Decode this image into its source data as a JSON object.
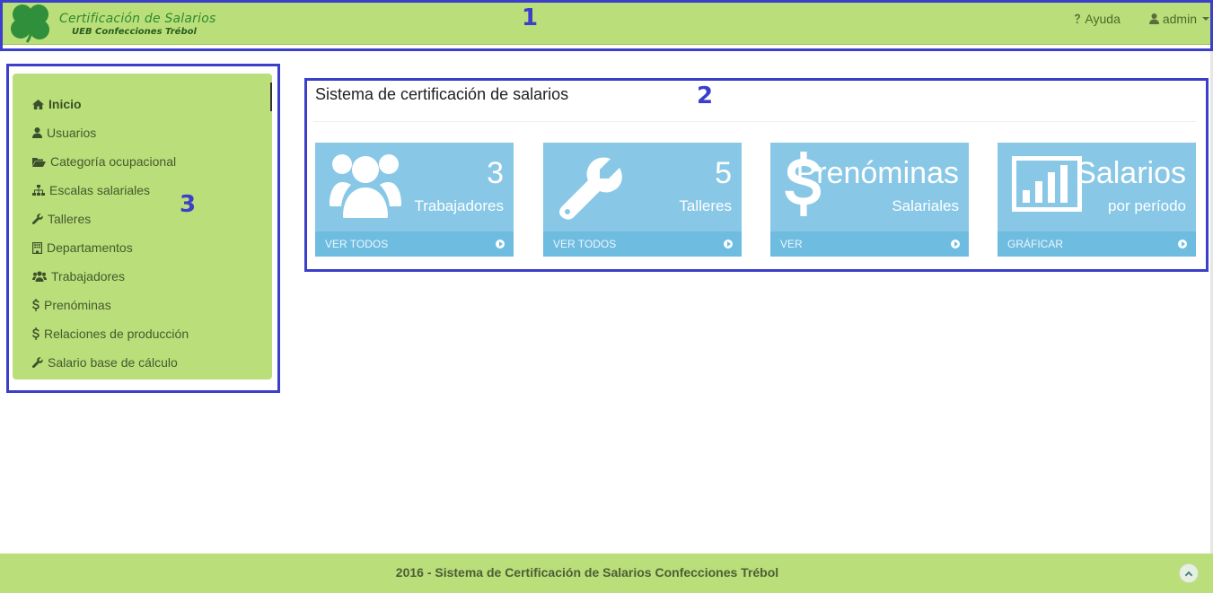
{
  "header": {
    "brand_title": "Certificación de Salarios",
    "brand_subtitle": "UEB Confecciones Trébol",
    "logo_icon": "clover-icon",
    "help_label": "Ayuda",
    "user_label": "admin"
  },
  "sidebar": {
    "items": [
      {
        "label": "Inicio",
        "icon": "home-icon",
        "active": true
      },
      {
        "label": "Usuarios",
        "icon": "user-icon"
      },
      {
        "label": "Categoría ocupacional",
        "icon": "folder-open-icon"
      },
      {
        "label": "Escalas salariales",
        "icon": "sitemap-icon"
      },
      {
        "label": "Talleres",
        "icon": "wrench-icon"
      },
      {
        "label": "Departamentos",
        "icon": "building-icon"
      },
      {
        "label": "Trabajadores",
        "icon": "users-icon"
      },
      {
        "label": "Prenóminas",
        "icon": "dollar-icon"
      },
      {
        "label": "Relaciones de producción",
        "icon": "dollar-icon"
      },
      {
        "label": "Salario base de cálculo",
        "icon": "wrench-icon"
      }
    ]
  },
  "main": {
    "title": "Sistema de certificación de salarios",
    "cards": [
      {
        "value": "3",
        "label": "Trabajadores",
        "link": "VER TODOS",
        "icon": "users-icon"
      },
      {
        "value": "5",
        "label": "Talleres",
        "link": "VER TODOS",
        "icon": "wrench-icon"
      },
      {
        "value": "Prenóminas",
        "label": "Salariales",
        "link": "VER",
        "icon": "dollar-icon"
      },
      {
        "value": "Salarios",
        "label": "por período",
        "link": "GRÁFICAR",
        "icon": "bar-chart-icon"
      }
    ]
  },
  "annotations": [
    "1",
    "2",
    "3"
  ],
  "footer": {
    "text": "2016 - Sistema de Certificación de Salarios Confecciones Trébol"
  },
  "colors": {
    "brand_green": "#bade79",
    "card_blue": "#88c8e6",
    "annotation_blue": "#3b3fc9"
  }
}
